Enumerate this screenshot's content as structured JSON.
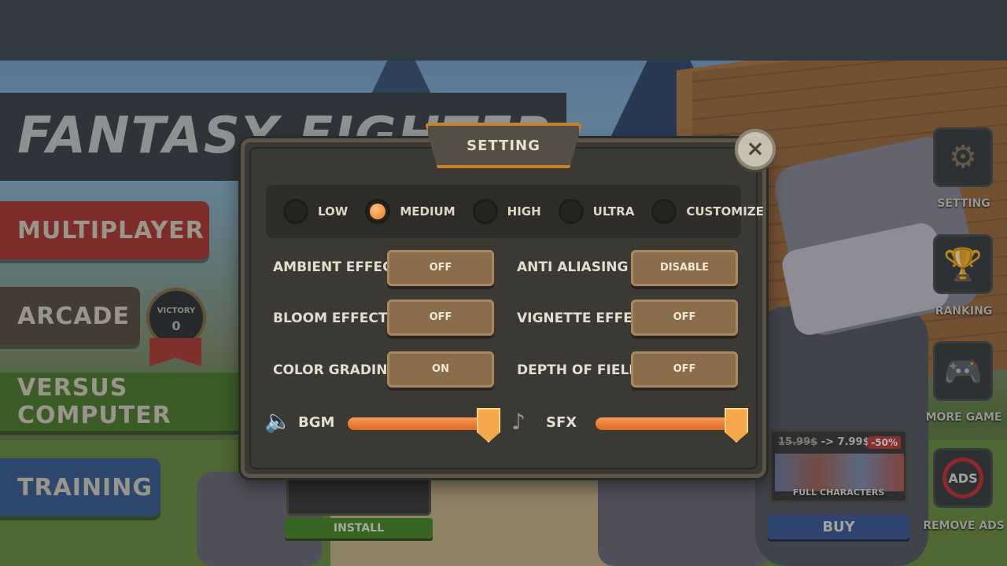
{
  "game_title": "FANTASY FIGHTER",
  "main_menu": {
    "multiplayer": "MULTIPLAYER",
    "arcade": "ARCADE",
    "versus_computer": "VERSUS COMPUTER",
    "training": "TRAINING",
    "victory_label": "VICTORY",
    "victory_count": "0"
  },
  "side_menu": {
    "setting": "SETTING",
    "ranking": "RANKING",
    "more_game": "MORE GAME",
    "remove_ads": "REMOVE ADS",
    "ads_icon_text": "ADS"
  },
  "promo": {
    "old_price": "15.99$",
    "arrow": "->",
    "new_price": "7.99$",
    "discount": "-50%",
    "caption": "FULL CHARACTERS",
    "buy": "BUY"
  },
  "install_label": "INSTALL",
  "dialog": {
    "title": "SETTING",
    "close_icon": "×",
    "quality": {
      "options": [
        "LOW",
        "MEDIUM",
        "HIGH",
        "ULTRA",
        "CUSTOMIZE"
      ],
      "selected": "MEDIUM"
    },
    "effects": {
      "ambient_effect": {
        "label": "AMBIENT EFFECT",
        "value": "OFF"
      },
      "bloom_effect": {
        "label": "BLOOM EFFECT",
        "value": "OFF"
      },
      "color_grading": {
        "label": "COLOR GRADING",
        "value": "ON"
      },
      "anti_aliasing": {
        "label": "ANTI ALIASING",
        "value": "DISABLE"
      },
      "vignette_effect": {
        "label": "VIGNETTE EFFECT",
        "value": "OFF"
      },
      "depth_of_field": {
        "label": "DEPTH OF FIELD",
        "value": "OFF"
      }
    },
    "audio": {
      "bgm": {
        "label": "BGM",
        "level": 1.0
      },
      "sfx": {
        "label": "SFX",
        "level": 1.0
      }
    }
  },
  "colors": {
    "accent_orange": "#e9782a",
    "panel": "#3a3934",
    "toggle": "#8a6d4a",
    "multiplayer": "#b0362f",
    "arcade": "#5a4d3c",
    "versus": "#4e7d2a",
    "training": "#3c5d96"
  }
}
